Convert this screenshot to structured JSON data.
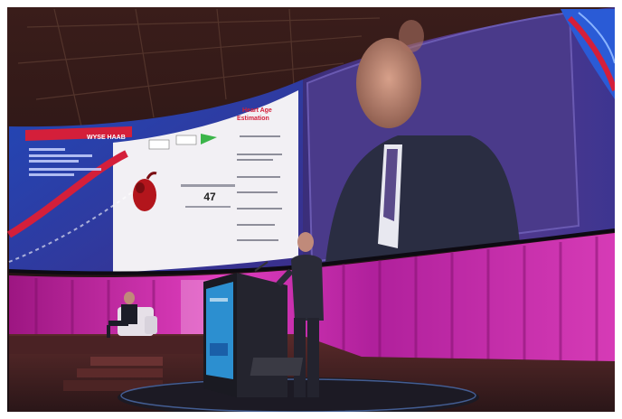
{
  "image": {
    "kind": "photograph",
    "subject": "conference-stage"
  },
  "screen": {
    "header_tag": "WYSE HAAB",
    "slide_heading": "Heart Age",
    "slide_subheading": "Estimation",
    "slide_number": "47"
  },
  "colors": {
    "curtain": "#c21a9b",
    "ceiling": "#2a1416",
    "screen_blue": "#2a5bd6",
    "slide_red": "#d41f3a",
    "podium_screen": "#2c8fd0"
  }
}
